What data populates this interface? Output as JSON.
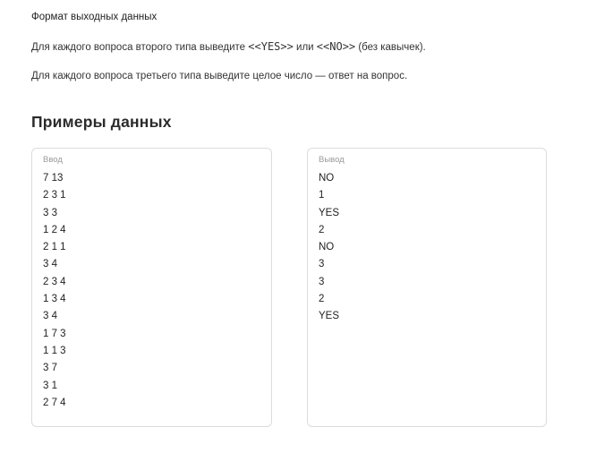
{
  "output_format": {
    "title": "Формат выходных данных",
    "line1": {
      "prefix": "Для каждого вопроса второго типа выведите ",
      "yes": "<<YES>>",
      "middle": " или ",
      "no": "<<NO>>",
      "suffix": " (без кавычек)."
    },
    "line2": "Для каждого вопроса третьего типа выведите целое число — ответ на вопрос."
  },
  "examples": {
    "title": "Примеры данных",
    "input": {
      "label": "Ввод",
      "lines": [
        "7 13",
        "2 3 1",
        "3 3",
        "1 2 4",
        "2 1 1",
        "3 4",
        "2 3 4",
        "1 3 4",
        "3 4",
        "1 7 3",
        "1 1 3",
        "3 7",
        "3 1",
        "2 7 4"
      ]
    },
    "output": {
      "label": "Вывод",
      "lines": [
        "NO",
        "1",
        "YES",
        "2",
        "NO",
        "3",
        "3",
        "2",
        "YES"
      ]
    }
  }
}
